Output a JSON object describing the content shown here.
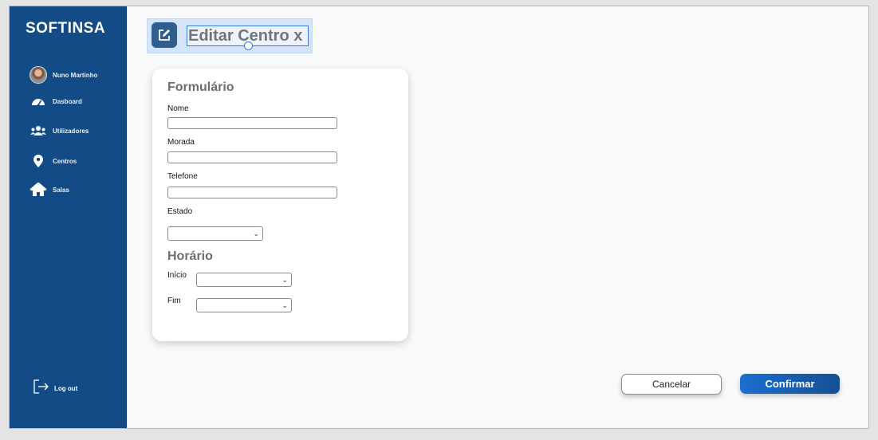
{
  "brand": "SOFTINSA",
  "user": {
    "name": "Nuno Martinho"
  },
  "sidebar": {
    "items": [
      {
        "label": "Dasboard",
        "icon": "dashboard-icon"
      },
      {
        "label": "Utilizadores",
        "icon": "users-icon"
      },
      {
        "label": "Centros",
        "icon": "map-pin-icon"
      },
      {
        "label": "Salas",
        "icon": "home-icon"
      }
    ],
    "logout": "Log out"
  },
  "header": {
    "title": "Editar Centro x"
  },
  "form": {
    "section_title": "Formulário",
    "fields": {
      "nome": {
        "label": "Nome",
        "value": ""
      },
      "morada": {
        "label": "Morada",
        "value": ""
      },
      "telefone": {
        "label": "Telefone",
        "value": ""
      },
      "estado": {
        "label": "Estado",
        "value": ""
      }
    },
    "schedule": {
      "title": "Horário",
      "inicio": {
        "label": "Início",
        "value": ""
      },
      "fim": {
        "label": "Fim",
        "value": ""
      }
    }
  },
  "actions": {
    "cancel": "Cancelar",
    "confirm": "Confirmar"
  },
  "colors": {
    "sidebar_bg": "#124b85",
    "confirm_start": "#1a6fd0",
    "confirm_end": "#164f93",
    "selection": "#d4e5fb"
  }
}
